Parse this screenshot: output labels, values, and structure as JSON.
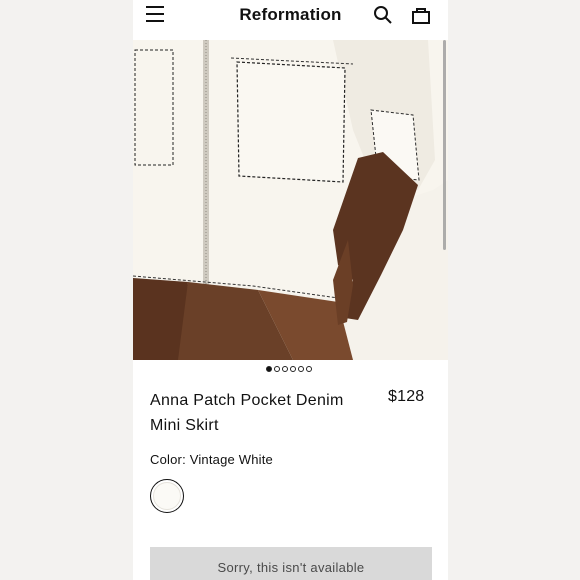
{
  "header": {
    "brand": "Reformation"
  },
  "icons": {
    "menu": "menu-icon",
    "search": "search-icon",
    "bag": "bag-icon"
  },
  "gallery": {
    "dots_total": 6,
    "active_index": 0
  },
  "product": {
    "title": "Anna Patch Pocket Denim Mini Skirt",
    "price": "$128",
    "color_label": "Color: Vintage White",
    "swatch_color": "#fbfaf6"
  },
  "cta": {
    "label": "Sorry, this isn't available"
  },
  "colors": {
    "background": "#f3f2f0",
    "panel": "#ffffff",
    "text": "#111111",
    "button_disabled": "#d9d9d9",
    "button_text": "#4a4a4a"
  }
}
